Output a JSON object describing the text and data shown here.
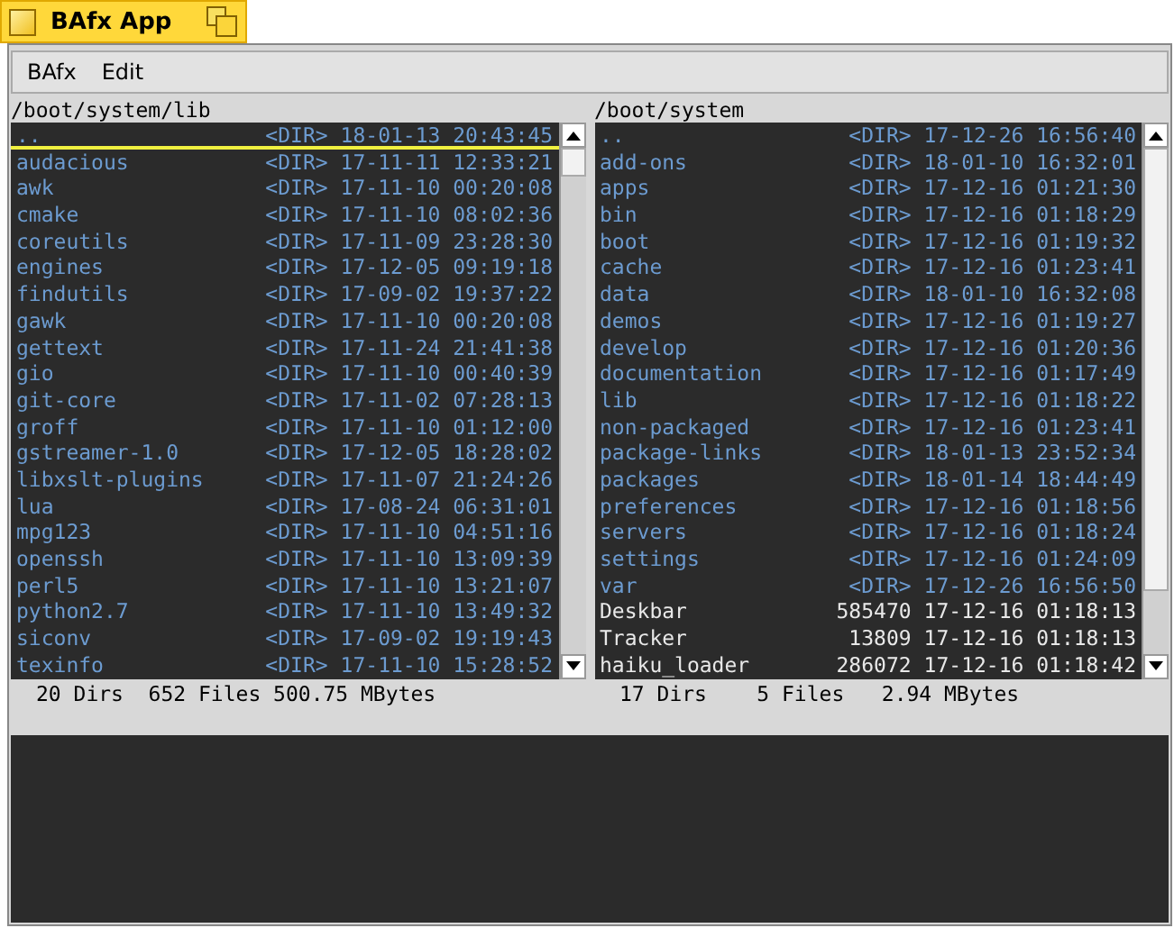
{
  "window": {
    "title": "BAfx App"
  },
  "menu": [
    "BAfx",
    "Edit"
  ],
  "panes": [
    {
      "path": "/boot/system/lib",
      "status": "20 Dirs  652 Files 500.75 MBytes",
      "entries": [
        {
          "name": "..",
          "kind": "dir",
          "size": "<DIR>",
          "date": "18-01-13 20:43:45",
          "selected": true
        },
        {
          "name": "audacious",
          "kind": "dir",
          "size": "<DIR>",
          "date": "17-11-11 12:33:21",
          "selected": false
        },
        {
          "name": "awk",
          "kind": "dir",
          "size": "<DIR>",
          "date": "17-11-10 00:20:08",
          "selected": false
        },
        {
          "name": "cmake",
          "kind": "dir",
          "size": "<DIR>",
          "date": "17-11-10 08:02:36",
          "selected": false
        },
        {
          "name": "coreutils",
          "kind": "dir",
          "size": "<DIR>",
          "date": "17-11-09 23:28:30",
          "selected": false
        },
        {
          "name": "engines",
          "kind": "dir",
          "size": "<DIR>",
          "date": "17-12-05 09:19:18",
          "selected": false
        },
        {
          "name": "findutils",
          "kind": "dir",
          "size": "<DIR>",
          "date": "17-09-02 19:37:22",
          "selected": false
        },
        {
          "name": "gawk",
          "kind": "dir",
          "size": "<DIR>",
          "date": "17-11-10 00:20:08",
          "selected": false
        },
        {
          "name": "gettext",
          "kind": "dir",
          "size": "<DIR>",
          "date": "17-11-24 21:41:38",
          "selected": false
        },
        {
          "name": "gio",
          "kind": "dir",
          "size": "<DIR>",
          "date": "17-11-10 00:40:39",
          "selected": false
        },
        {
          "name": "git-core",
          "kind": "dir",
          "size": "<DIR>",
          "date": "17-11-02 07:28:13",
          "selected": false
        },
        {
          "name": "groff",
          "kind": "dir",
          "size": "<DIR>",
          "date": "17-11-10 01:12:00",
          "selected": false
        },
        {
          "name": "gstreamer-1.0",
          "kind": "dir",
          "size": "<DIR>",
          "date": "17-12-05 18:28:02",
          "selected": false
        },
        {
          "name": "libxslt-plugins",
          "kind": "dir",
          "size": "<DIR>",
          "date": "17-11-07 21:24:26",
          "selected": false
        },
        {
          "name": "lua",
          "kind": "dir",
          "size": "<DIR>",
          "date": "17-08-24 06:31:01",
          "selected": false
        },
        {
          "name": "mpg123",
          "kind": "dir",
          "size": "<DIR>",
          "date": "17-11-10 04:51:16",
          "selected": false
        },
        {
          "name": "openssh",
          "kind": "dir",
          "size": "<DIR>",
          "date": "17-11-10 13:09:39",
          "selected": false
        },
        {
          "name": "perl5",
          "kind": "dir",
          "size": "<DIR>",
          "date": "17-11-10 13:21:07",
          "selected": false
        },
        {
          "name": "python2.7",
          "kind": "dir",
          "size": "<DIR>",
          "date": "17-11-10 13:49:32",
          "selected": false
        },
        {
          "name": "siconv",
          "kind": "dir",
          "size": "<DIR>",
          "date": "17-09-02 19:19:43",
          "selected": false
        },
        {
          "name": "texinfo",
          "kind": "dir",
          "size": "<DIR>",
          "date": "17-11-10 15:28:52",
          "selected": false
        }
      ]
    },
    {
      "path": "/boot/system",
      "status": "17 Dirs    5 Files   2.94 MBytes",
      "entries": [
        {
          "name": "..",
          "kind": "dir",
          "size": "<DIR>",
          "date": "17-12-26 16:56:40",
          "selected": false
        },
        {
          "name": "add-ons",
          "kind": "dir",
          "size": "<DIR>",
          "date": "18-01-10 16:32:01",
          "selected": false
        },
        {
          "name": "apps",
          "kind": "dir",
          "size": "<DIR>",
          "date": "17-12-16 01:21:30",
          "selected": false
        },
        {
          "name": "bin",
          "kind": "dir",
          "size": "<DIR>",
          "date": "17-12-16 01:18:29",
          "selected": false
        },
        {
          "name": "boot",
          "kind": "dir",
          "size": "<DIR>",
          "date": "17-12-16 01:19:32",
          "selected": false
        },
        {
          "name": "cache",
          "kind": "dir",
          "size": "<DIR>",
          "date": "17-12-16 01:23:41",
          "selected": false
        },
        {
          "name": "data",
          "kind": "dir",
          "size": "<DIR>",
          "date": "18-01-10 16:32:08",
          "selected": false
        },
        {
          "name": "demos",
          "kind": "dir",
          "size": "<DIR>",
          "date": "17-12-16 01:19:27",
          "selected": false
        },
        {
          "name": "develop",
          "kind": "dir",
          "size": "<DIR>",
          "date": "17-12-16 01:20:36",
          "selected": false
        },
        {
          "name": "documentation",
          "kind": "dir",
          "size": "<DIR>",
          "date": "17-12-16 01:17:49",
          "selected": false
        },
        {
          "name": "lib",
          "kind": "dir",
          "size": "<DIR>",
          "date": "17-12-16 01:18:22",
          "selected": false
        },
        {
          "name": "non-packaged",
          "kind": "dir",
          "size": "<DIR>",
          "date": "17-12-16 01:23:41",
          "selected": false
        },
        {
          "name": "package-links",
          "kind": "dir",
          "size": "<DIR>",
          "date": "18-01-13 23:52:34",
          "selected": false
        },
        {
          "name": "packages",
          "kind": "dir",
          "size": "<DIR>",
          "date": "18-01-14 18:44:49",
          "selected": false
        },
        {
          "name": "preferences",
          "kind": "dir",
          "size": "<DIR>",
          "date": "17-12-16 01:18:56",
          "selected": false
        },
        {
          "name": "servers",
          "kind": "dir",
          "size": "<DIR>",
          "date": "17-12-16 01:18:24",
          "selected": false
        },
        {
          "name": "settings",
          "kind": "dir",
          "size": "<DIR>",
          "date": "17-12-16 01:24:09",
          "selected": false
        },
        {
          "name": "var",
          "kind": "dir",
          "size": "<DIR>",
          "date": "17-12-26 16:56:50",
          "selected": false
        },
        {
          "name": "Deskbar",
          "kind": "file",
          "size": "585470",
          "date": "17-12-16 01:18:13",
          "selected": false
        },
        {
          "name": "Tracker",
          "kind": "file",
          "size": "13809",
          "date": "17-12-16 01:18:13",
          "selected": false
        },
        {
          "name": "haiku_loader",
          "kind": "file",
          "size": "286072",
          "date": "17-12-16 01:18:42",
          "selected": false
        }
      ]
    }
  ]
}
